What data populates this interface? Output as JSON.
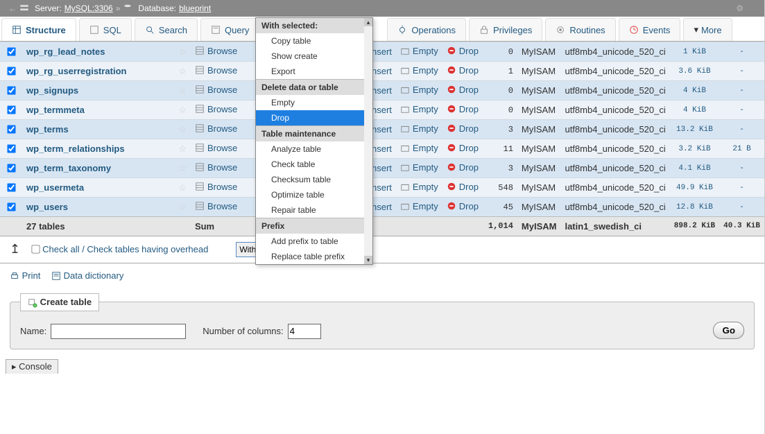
{
  "breadcrumb": {
    "server_label": "Server:",
    "server_value": "MySQL:3306",
    "database_label": "Database:",
    "database_value": "blueprint"
  },
  "tabs": [
    {
      "id": "structure",
      "label": "Structure",
      "active": true
    },
    {
      "id": "sql",
      "label": "SQL"
    },
    {
      "id": "search",
      "label": "Search"
    },
    {
      "id": "query",
      "label": "Query"
    },
    {
      "id": "operations",
      "label": "Operations"
    },
    {
      "id": "privileges",
      "label": "Privileges"
    },
    {
      "id": "routines",
      "label": "Routines"
    },
    {
      "id": "events",
      "label": "Events"
    },
    {
      "id": "more",
      "label": "More",
      "is_more": true
    }
  ],
  "row_action_labels": {
    "browse": "Browse",
    "insert": "Insert",
    "empty": "Empty",
    "drop": "Drop"
  },
  "tables": [
    {
      "name": "wp_rg_lead_notes",
      "rows": 0,
      "engine": "MyISAM",
      "collation": "utf8mb4_unicode_520_ci",
      "size": "1 KiB",
      "overhead": "-"
    },
    {
      "name": "wp_rg_userregistration",
      "rows": 1,
      "engine": "MyISAM",
      "collation": "utf8mb4_unicode_520_ci",
      "size": "3.6 KiB",
      "overhead": "-"
    },
    {
      "name": "wp_signups",
      "rows": 0,
      "engine": "MyISAM",
      "collation": "utf8mb4_unicode_520_ci",
      "size": "4 KiB",
      "overhead": "-"
    },
    {
      "name": "wp_termmeta",
      "rows": 0,
      "engine": "MyISAM",
      "collation": "utf8mb4_unicode_520_ci",
      "size": "4 KiB",
      "overhead": "-"
    },
    {
      "name": "wp_terms",
      "rows": 3,
      "engine": "MyISAM",
      "collation": "utf8mb4_unicode_520_ci",
      "size": "13.2 KiB",
      "overhead": "-"
    },
    {
      "name": "wp_term_relationships",
      "rows": 11,
      "engine": "MyISAM",
      "collation": "utf8mb4_unicode_520_ci",
      "size": "3.2 KiB",
      "overhead": "21 B"
    },
    {
      "name": "wp_term_taxonomy",
      "rows": 3,
      "engine": "MyISAM",
      "collation": "utf8mb4_unicode_520_ci",
      "size": "4.1 KiB",
      "overhead": "-"
    },
    {
      "name": "wp_usermeta",
      "rows": 548,
      "engine": "MyISAM",
      "collation": "utf8mb4_unicode_520_ci",
      "size": "49.9 KiB",
      "overhead": "-"
    },
    {
      "name": "wp_users",
      "rows": 45,
      "engine": "MyISAM",
      "collation": "utf8mb4_unicode_520_ci",
      "size": "12.8 KiB",
      "overhead": "-"
    }
  ],
  "summary": {
    "count_label": "27 tables",
    "sum_label": "Sum",
    "rows_total": "1,014",
    "engine": "MyISAM",
    "collation": "latin1_swedish_ci",
    "size": "898.2 KiB",
    "overhead": "40.3 KiB"
  },
  "checkall": {
    "check_all": "Check all",
    "divider": " / ",
    "check_overhead": "Check tables having overhead"
  },
  "with_selected": {
    "placeholder": "With selected:"
  },
  "dropdown_menu": {
    "groups": [
      {
        "header": "With selected:",
        "items": [
          "Copy table",
          "Show create",
          "Export"
        ]
      },
      {
        "header": "Delete data or table",
        "items": [
          "Empty",
          "Drop"
        ],
        "highlight": "Drop"
      },
      {
        "header": "Table maintenance",
        "items": [
          "Analyze table",
          "Check table",
          "Checksum table",
          "Optimize table",
          "Repair table"
        ]
      },
      {
        "header": "Prefix",
        "items": [
          "Add prefix to table",
          "Replace table prefix"
        ]
      }
    ]
  },
  "printrow": {
    "print": "Print",
    "data_dictionary": "Data dictionary"
  },
  "create_table": {
    "legend": "Create table",
    "name_label": "Name:",
    "cols_label": "Number of columns:",
    "cols_value": "4",
    "go": "Go"
  },
  "console": {
    "label": "Console"
  }
}
